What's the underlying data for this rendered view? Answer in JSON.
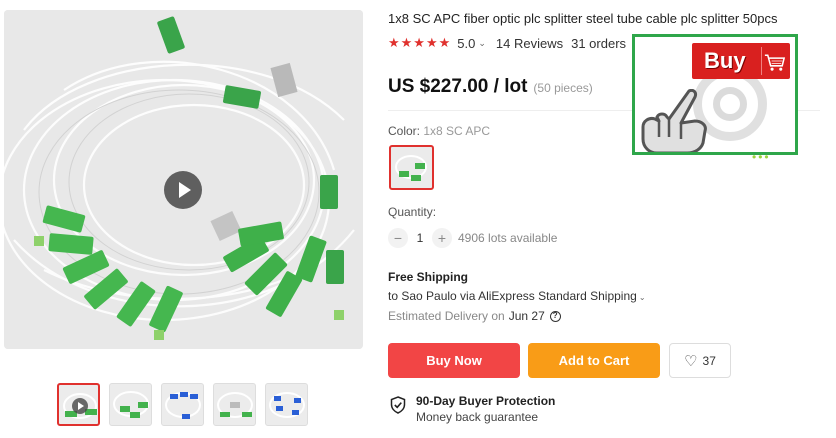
{
  "product": {
    "title": "1x8 SC APC fiber optic plc splitter steel tube cable plc splitter 50pcs",
    "rating_score": "5.0",
    "reviews": "14 Reviews",
    "orders": "31 orders",
    "price": "US $227.00 / lot",
    "pieces": "(50 pieces)"
  },
  "options": {
    "color_label": "Color:",
    "color_value": "1x8 SC APC",
    "quantity_label": "Quantity:",
    "quantity_value": "1",
    "quantity_minus": "−",
    "quantity_plus": "+",
    "available": "4906 lots available"
  },
  "shipping": {
    "title": "Free Shipping",
    "line": "to Sao Paulo via AliExpress Standard Shipping",
    "estimated_label": "Estimated Delivery on",
    "estimated_date": "Jun 27"
  },
  "actions": {
    "buy_now": "Buy Now",
    "add_to_cart": "Add to Cart",
    "wishlist_count": "37"
  },
  "protection": {
    "title": "90-Day Buyer Protection",
    "subtitle": "Money back guarantee"
  },
  "overlay": {
    "buy_label": "Buy"
  },
  "colors": {
    "accent_red": "#e0312e",
    "buy_now_bg": "#f24545",
    "add_cart_bg": "#f99c17",
    "overlay_border": "#2ea64a"
  },
  "icons": {
    "stars": "★★★★★",
    "heart": "♡",
    "chevron": "⌄"
  }
}
